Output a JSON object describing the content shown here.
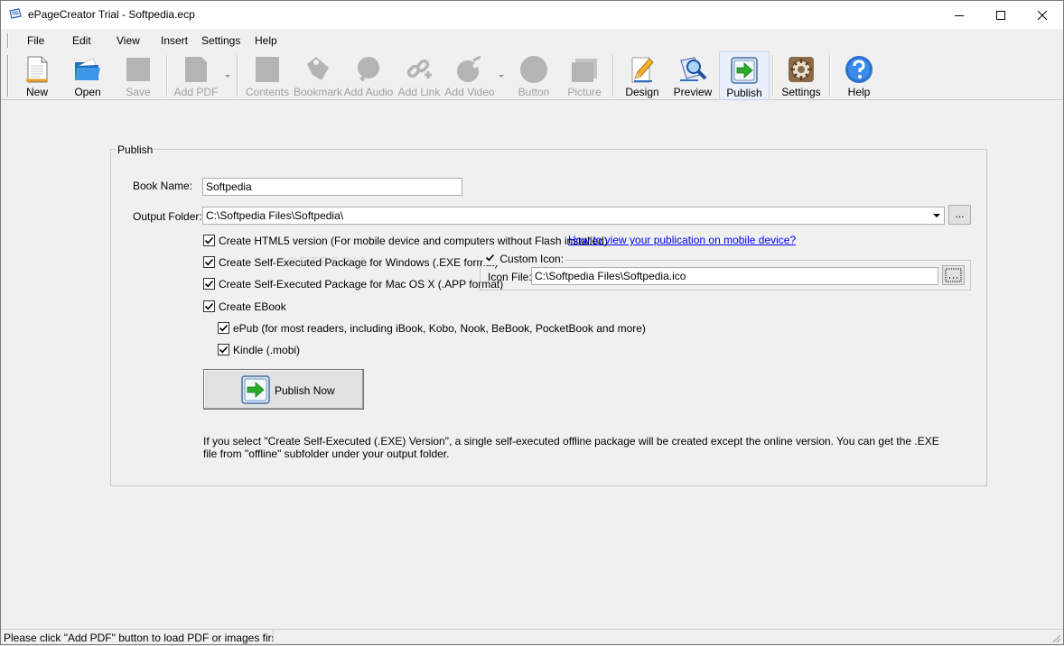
{
  "window": {
    "title": "ePageCreator Trial - Softpedia.ecp"
  },
  "menu": {
    "file": "File",
    "edit": "Edit",
    "view": "View",
    "insert": "Insert",
    "settings": "Settings",
    "help": "Help"
  },
  "toolbar": {
    "new": "New",
    "open": "Open",
    "save": "Save",
    "add_pdf": "Add PDF",
    "contents": "Contents",
    "bookmark": "Bookmark",
    "add_audio": "Add Audio",
    "add_link": "Add Link",
    "add_video": "Add Video",
    "button": "Button",
    "picture": "Picture",
    "design": "Design",
    "preview": "Preview",
    "publish": "Publish",
    "settings": "Settings",
    "help": "Help"
  },
  "publish": {
    "group_title": "Publish",
    "book_name_label": "Book Name:",
    "book_name_value": "Softpedia",
    "output_folder_label": "Output Folder:",
    "output_folder_value": "C:\\Softpedia Files\\Softpedia\\",
    "browse_label": "...",
    "html5_label": "Create HTML5 version (For mobile device and computers without Flash installed)",
    "html5_checked": true,
    "mobile_link": "How to view your publication on mobile device?",
    "exe_label": "Create Self-Executed Package for Windows (.EXE format)",
    "exe_checked": true,
    "app_label": "Create Self-Executed Package for Mac OS X (.APP format)",
    "app_checked": true,
    "custom_icon_label": "Custom Icon:",
    "custom_icon_checked": true,
    "icon_file_label": "Icon File:",
    "icon_file_value": "C:\\Softpedia Files\\Softpedia.ico",
    "ebook_label": "Create EBook",
    "ebook_checked": true,
    "epub_label": "ePub (for most readers, including iBook, Kobo, Nook, BeBook, PocketBook and more)",
    "epub_checked": true,
    "kindle_label": "Kindle (.mobi)",
    "kindle_checked": true,
    "publish_now": "Publish Now",
    "note": "If you select \"Create Self-Executed (.EXE) Version\", a single self-executed offline package will be created except the online version. You can get the .EXE file from \"offline\" subfolder under your output folder."
  },
  "status": {
    "text": "Please click \"Add PDF\" button to load PDF or images first"
  },
  "watermark": "SOFTPEDIA",
  "colors": {
    "link": "#0000ff",
    "disabled_text": "#a0a0a0",
    "publish_green": "#2eaa2e"
  }
}
